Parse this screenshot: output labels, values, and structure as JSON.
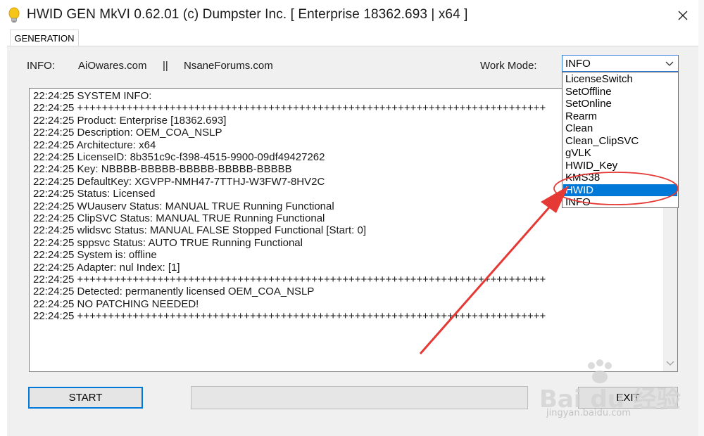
{
  "window": {
    "title": "HWID GEN MkVI 0.62.01 (c) Dumpster Inc. [ Enterprise 18362.693 | x64 ]",
    "close_glyph": "✕"
  },
  "tabs": [
    {
      "label": "GENERATION",
      "active": true
    }
  ],
  "info": {
    "label": "INFO:",
    "link1": "AiOwares.com",
    "separator": "||",
    "link2": "NsaneForums.com"
  },
  "work_mode": {
    "label": "Work Mode:",
    "selected": "INFO",
    "highlighted": "HWID",
    "options": [
      "LicenseSwitch",
      "SetOffline",
      "SetOnline",
      "Rearm",
      "Clean",
      "Clean_ClipSVC",
      "gVLK",
      "HWID_Key",
      "KMS38",
      "HWID",
      "INFO"
    ]
  },
  "log": [
    "22:24:25 SYSTEM INFO:",
    "22:24:25 ++++++++++++++++++++++++++++++++++++++++++++++++++++++++++++++++++++++++++++",
    "22:24:25 Product: Enterprise [18362.693]",
    "22:24:25 Description: OEM_COA_NSLP",
    "22:24:25 Architecture: x64",
    "22:24:25 LicenseID: 8b351c9c-f398-4515-9900-09df49427262",
    "22:24:25 Key: NBBBB-BBBBB-BBBBB-BBBBB-BBBBB",
    "22:24:25 DefaultKey: XGVPP-NMH47-7TTHJ-W3FW7-8HV2C",
    "22:24:25 Status: Licensed",
    "22:24:25 WUauserv Status: MANUAL TRUE Running Functional",
    "22:24:25 ClipSVC Status: MANUAL TRUE Running Functional",
    "22:24:25 wlidsvc Status: MANUAL FALSE Stopped Functional [Start: 0]",
    "22:24:25 sppsvc Status: AUTO TRUE Running Functional",
    "22:24:25 System is: offline",
    "22:24:25 Adapter: nul Index: [1]",
    "22:24:25 ++++++++++++++++++++++++++++++++++++++++++++++++++++++++++++++++++++++++++++",
    "22:24:25 Detected: permanently licensed OEM_COA_NSLP",
    "22:24:25 NO PATCHING NEEDED!",
    "22:24:25 ++++++++++++++++++++++++++++++++++++++++++++++++++++++++++++++++++++++++++++"
  ],
  "buttons": {
    "start": "START",
    "exit": "EXIT"
  },
  "progress": {
    "value": 0
  },
  "watermark": {
    "text": "Bai du 经验",
    "sub": "jingyan.baidu.com"
  },
  "colors": {
    "accent": "#0078d7",
    "annotation": "#e53935"
  },
  "icons": {
    "title": "lightbulb-icon",
    "close": "close-icon",
    "combo": "chevron-down-icon"
  }
}
